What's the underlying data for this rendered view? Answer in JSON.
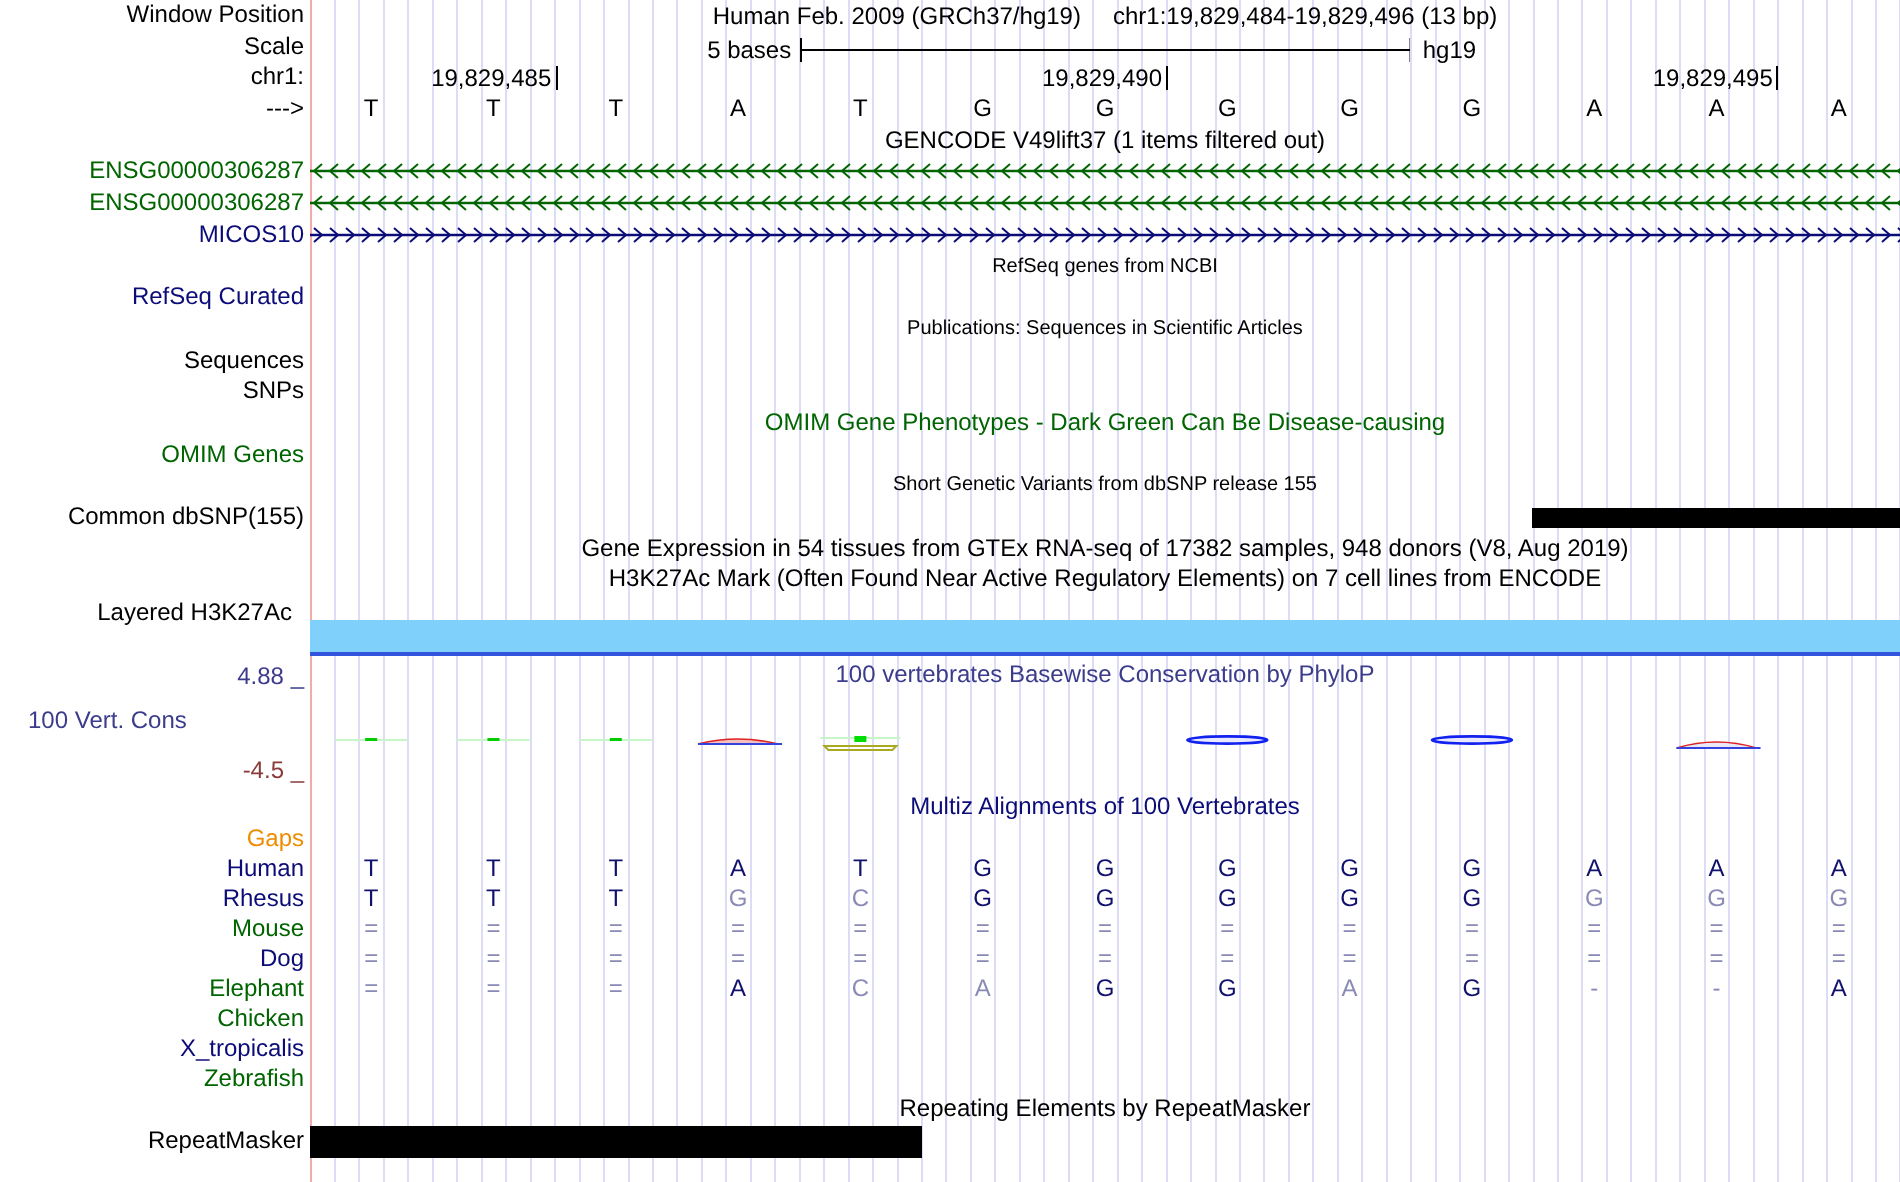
{
  "header": {
    "position_label": "Window Position",
    "assembly": "Human Feb. 2009 (GRCh37/hg19)",
    "position": "chr1:19,829,484-19,829,496 (13 bp)",
    "scale_label": "Scale",
    "scale_text": "5 bases",
    "scale_db": "hg19",
    "chrom_label": "chr1:",
    "ruler": [
      "19,829,485",
      "19,829,490",
      "19,829,495"
    ],
    "strand_label": "--->",
    "bases": [
      "T",
      "T",
      "T",
      "A",
      "T",
      "G",
      "G",
      "G",
      "G",
      "G",
      "A",
      "A",
      "A"
    ]
  },
  "rows": [
    {
      "kind": "title",
      "text": "GENCODE V49lift37 (1 items filtered out)",
      "small": false,
      "color": "#000000"
    },
    {
      "kind": "gene",
      "label": "ENSG00000306287",
      "reverse": true,
      "color": "#006400"
    },
    {
      "kind": "gene",
      "label": "ENSG00000306287",
      "reverse": true,
      "color": "#006400"
    },
    {
      "kind": "gene",
      "label": "MICOS10",
      "reverse": false,
      "color": "#0c0c78"
    },
    {
      "kind": "title",
      "text": "RefSeq genes from NCBI",
      "small": true,
      "color": "#000000"
    },
    {
      "kind": "label",
      "label": "RefSeq Curated",
      "color": "#0c0c78"
    },
    {
      "kind": "title",
      "text": "Publications: Sequences in Scientific Articles",
      "small": true,
      "color": "#000000"
    },
    {
      "kind": "label",
      "label": "Sequences",
      "color": "#000000"
    },
    {
      "kind": "label",
      "label": "SNPs",
      "color": "#000000"
    },
    {
      "kind": "title",
      "text": "OMIM Gene Phenotypes - Dark Green Can Be Disease-causing",
      "small": false,
      "color": "#006400"
    },
    {
      "kind": "label",
      "label": "OMIM Genes",
      "color": "#006400"
    },
    {
      "kind": "title",
      "text": "Short Genetic Variants from dbSNP release 155",
      "small": true,
      "color": "#000000"
    },
    {
      "kind": "bar",
      "label": "Common dbSNP(155)",
      "color": "#000000",
      "from_end": true,
      "level": 0.231
    },
    {
      "kind": "title",
      "text": "Gene Expression in 54 tissues from GTEx RNA-seq of 17382 samples, 948 donors (V8, Aug 2019)",
      "small": false,
      "color": "#000000"
    },
    {
      "kind": "title",
      "text": "H3K27Ac Mark (Often Found Near Active Regulatory Elements) on 7 cell lines from ENCODE",
      "small": false,
      "color": "#000000"
    },
    {
      "kind": "signal",
      "label": "Layered H3K27Ac",
      "color": "#000000"
    },
    {
      "kind": "wiggle",
      "label": "100 Vert. Cons",
      "max": "4.88 _",
      "min": "-4.5 _",
      "title": "100 vertebrates Basewise Conservation by PhyloP",
      "color": "#3c3c8c"
    },
    {
      "kind": "title",
      "text": "Multiz Alignments of 100 Vertebrates",
      "small": false,
      "color": "#0c0c78"
    },
    {
      "kind": "label",
      "label": "Gaps",
      "color": "#ef8c00"
    },
    {
      "kind": "alignment",
      "label": "Human",
      "color": "#0c0c78",
      "bases": [
        "T",
        "T",
        "T",
        "A",
        "T",
        "G",
        "G",
        "G",
        "G",
        "G",
        "A",
        "A",
        "A"
      ]
    },
    {
      "kind": "alignment",
      "label": "Rhesus",
      "color": "#0c0c78",
      "bases": [
        "T",
        "T",
        "T",
        "G",
        "C",
        "G",
        "G",
        "G",
        "G",
        "G",
        "G",
        "G",
        "G"
      ]
    },
    {
      "kind": "alignment",
      "label": "Mouse",
      "color": "#006400",
      "bases": [
        "=",
        "=",
        "=",
        "=",
        "=",
        "=",
        "=",
        "=",
        "=",
        "=",
        "=",
        "=",
        "="
      ]
    },
    {
      "kind": "alignment",
      "label": "Dog",
      "color": "#0c0c78",
      "bases": [
        "=",
        "=",
        "=",
        "=",
        "=",
        "=",
        "=",
        "=",
        "=",
        "=",
        "=",
        "=",
        "="
      ]
    },
    {
      "kind": "alignment",
      "label": "Elephant",
      "color": "#006400",
      "bases": [
        "=",
        "=",
        "=",
        "A",
        "C",
        "A",
        "G",
        "G",
        "A",
        "G",
        "-",
        "-",
        "A"
      ]
    },
    {
      "kind": "alignment",
      "label": "Chicken",
      "color": "#006400"
    },
    {
      "kind": "alignment",
      "label": "X_tropicalis",
      "color": "#0c0c78"
    },
    {
      "kind": "alignment",
      "label": "Zebrafish",
      "color": "#006400"
    },
    {
      "kind": "title",
      "text": "Repeating Elements by RepeatMasker",
      "small": false,
      "color": "#000000"
    },
    {
      "kind": "bar",
      "label": "RepeatMasker",
      "color": "#000000",
      "from_end": false,
      "level": 0.385
    }
  ]
}
